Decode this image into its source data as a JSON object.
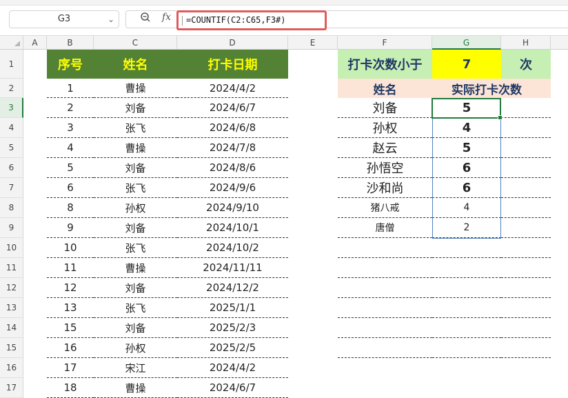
{
  "name_box": "G3",
  "formula": "=COUNTIF(C2:C65,F3#)",
  "columns": [
    "A",
    "B",
    "C",
    "D",
    "E",
    "F",
    "G",
    "H"
  ],
  "rows": [
    "1",
    "2",
    "3",
    "4",
    "5",
    "6",
    "7",
    "8",
    "9",
    "10",
    "11",
    "12",
    "13",
    "14",
    "15",
    "16",
    "17"
  ],
  "left_table": {
    "headers": [
      "序号",
      "姓名",
      "打卡日期"
    ],
    "rows": [
      [
        "1",
        "曹操",
        "2024/4/2"
      ],
      [
        "2",
        "刘备",
        "2024/6/7"
      ],
      [
        "3",
        "张飞",
        "2024/6/8"
      ],
      [
        "4",
        "曹操",
        "2024/7/8"
      ],
      [
        "5",
        "刘备",
        "2024/8/6"
      ],
      [
        "6",
        "张飞",
        "2024/9/6"
      ],
      [
        "8",
        "孙权",
        "2024/9/10"
      ],
      [
        "9",
        "刘备",
        "2024/10/1"
      ],
      [
        "10",
        "张飞",
        "2024/10/2"
      ],
      [
        "11",
        "曹操",
        "2024/11/11"
      ],
      [
        "12",
        "刘备",
        "2024/12/2"
      ],
      [
        "13",
        "张飞",
        "2025/1/1"
      ],
      [
        "15",
        "刘备",
        "2025/2/3"
      ],
      [
        "16",
        "孙权",
        "2025/2/5"
      ],
      [
        "17",
        "宋江",
        "2024/4/2"
      ],
      [
        "18",
        "曹操",
        "2024/6/7"
      ]
    ]
  },
  "right_table": {
    "criteria_label": "打卡次数小于",
    "criteria_value": "7",
    "criteria_unit": "次",
    "headers": [
      "姓名",
      "实际打卡次数"
    ],
    "rows": [
      [
        "刘备",
        "5"
      ],
      [
        "孙权",
        "4"
      ],
      [
        "赵云",
        "5"
      ],
      [
        "孙悟空",
        "6"
      ],
      [
        "沙和尚",
        "6"
      ],
      [
        "猪八戒",
        "4"
      ],
      [
        "唐僧",
        "2"
      ]
    ]
  }
}
